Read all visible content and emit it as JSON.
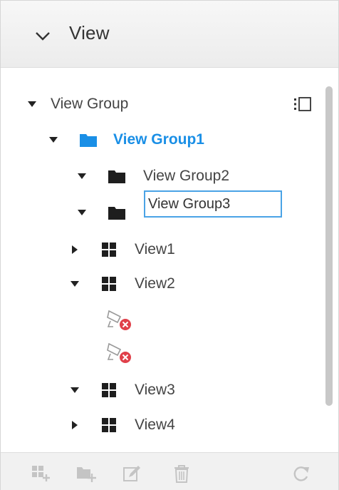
{
  "header": {
    "title": "View"
  },
  "tree": {
    "root": "View Group",
    "group1": "View Group1",
    "group2": "View Group2",
    "group3_edit": "View Group3",
    "view1": "View1",
    "view2": "View2",
    "view3": "View3",
    "view4": "View4"
  },
  "colors": {
    "selected": "#1a8fe6",
    "error": "#e0404a"
  },
  "icons": [
    "chevron-down-icon",
    "caret-down-icon",
    "caret-right-icon",
    "folder-icon",
    "grid-view-icon",
    "camera-offline-icon",
    "list-toggle-icon",
    "add-view-icon",
    "add-group-icon",
    "edit-icon",
    "delete-icon",
    "refresh-icon"
  ]
}
